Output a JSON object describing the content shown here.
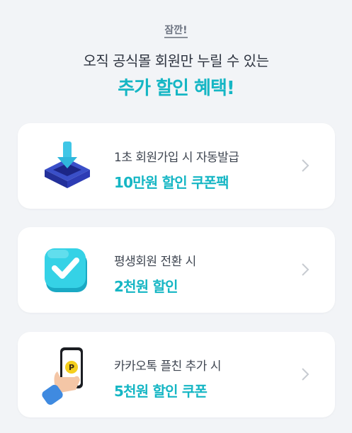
{
  "header": {
    "eyebrow": "잠깐!",
    "subtitle": "오직 공식몰 회원만 누릴 수 있는",
    "title": "추가 할인 혜택!"
  },
  "benefits": [
    {
      "icon": "inbox-download-icon",
      "line1": "1초 회원가입 시 자동발급",
      "line2": "10만원 할인 쿠폰팩"
    },
    {
      "icon": "checkmark-icon",
      "line1": "평생회원 전환 시",
      "line2": "2천원 할인"
    },
    {
      "icon": "phone-kakao-icon",
      "line1": "카카오톡 플친 추가 시",
      "line2": "5천원 할인 쿠폰"
    }
  ],
  "colors": {
    "accent": "#15b6c4",
    "background": "#f2f4f7",
    "card": "#ffffff"
  }
}
